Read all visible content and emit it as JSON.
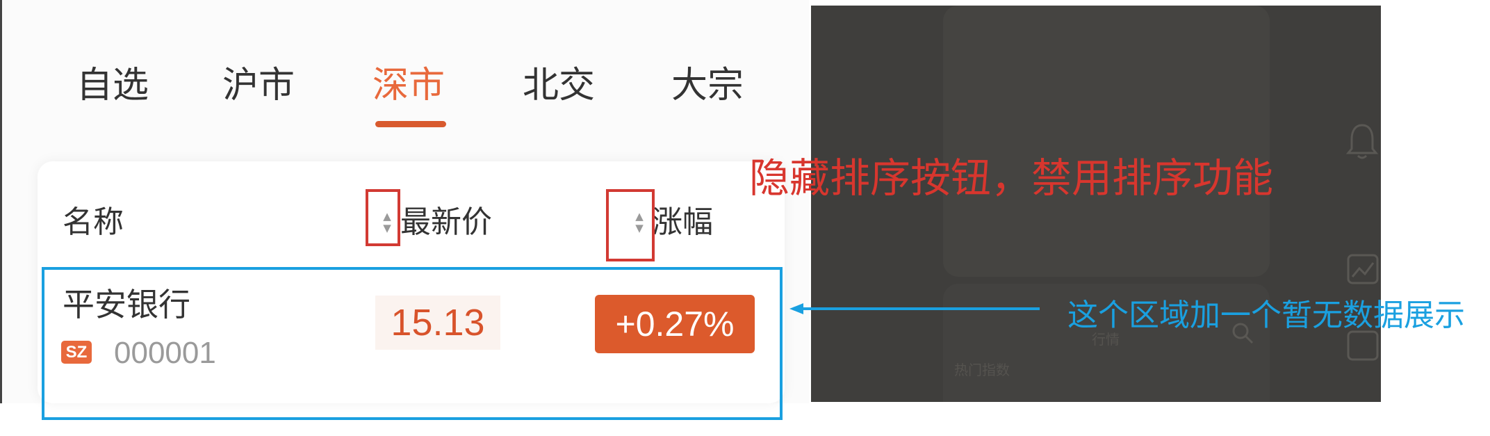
{
  "tabs": [
    {
      "label": "自选",
      "active": false
    },
    {
      "label": "沪市",
      "active": false
    },
    {
      "label": "深市",
      "active": true
    },
    {
      "label": "北交",
      "active": false
    },
    {
      "label": "大宗",
      "active": false
    }
  ],
  "table": {
    "headers": {
      "name": "名称",
      "price": "最新价",
      "change": "涨幅"
    },
    "rows": [
      {
        "name": "平安银行",
        "market": "SZ",
        "code": "000001",
        "price": "15.13",
        "change": "+0.27%"
      }
    ]
  },
  "background_panel": {
    "text_1": "热门指数",
    "text_2": "行情"
  },
  "annotations": {
    "sort_note": "隐藏排序按钮，禁用排序功能",
    "empty_note": "这个区域加一个暂无数据展示"
  },
  "colors": {
    "accent": "#e8693c",
    "annotation_red": "#d8362e",
    "annotation_blue": "#1aa0e0",
    "dark_panel": "#3f3e3c"
  }
}
